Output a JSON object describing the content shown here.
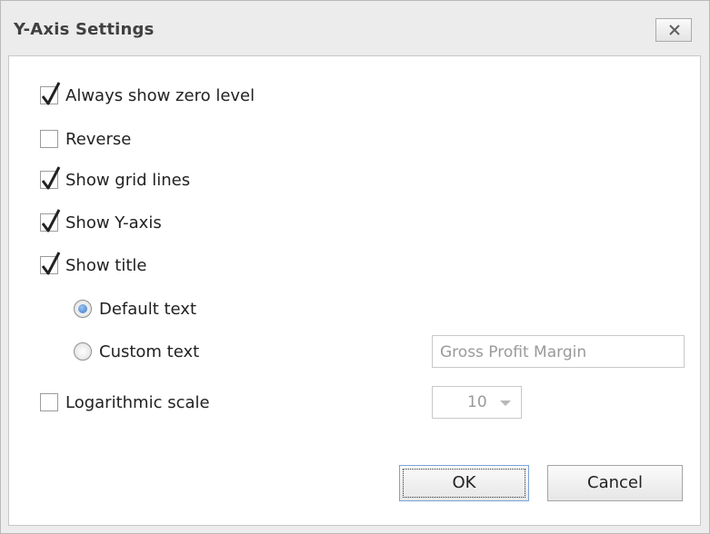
{
  "dialog": {
    "title": "Y-Axis Settings"
  },
  "options": {
    "always_show_zero": {
      "label": "Always show zero level",
      "checked": true
    },
    "reverse": {
      "label": "Reverse",
      "checked": false
    },
    "show_grid_lines": {
      "label": "Show grid lines",
      "checked": true
    },
    "show_y_axis": {
      "label": "Show Y-axis",
      "checked": true
    },
    "show_title": {
      "label": "Show title",
      "checked": true
    },
    "logarithmic_scale": {
      "label": "Logarithmic scale",
      "checked": false
    }
  },
  "title_mode": {
    "default_label": "Default text",
    "custom_label": "Custom text",
    "selected": "default",
    "custom_value": "Gross Profit Margin"
  },
  "log_base": {
    "value": "10"
  },
  "buttons": {
    "ok": "OK",
    "cancel": "Cancel"
  },
  "icons": {
    "close": "close-icon",
    "check": "check-icon",
    "dropdown": "chevron-down-icon"
  }
}
